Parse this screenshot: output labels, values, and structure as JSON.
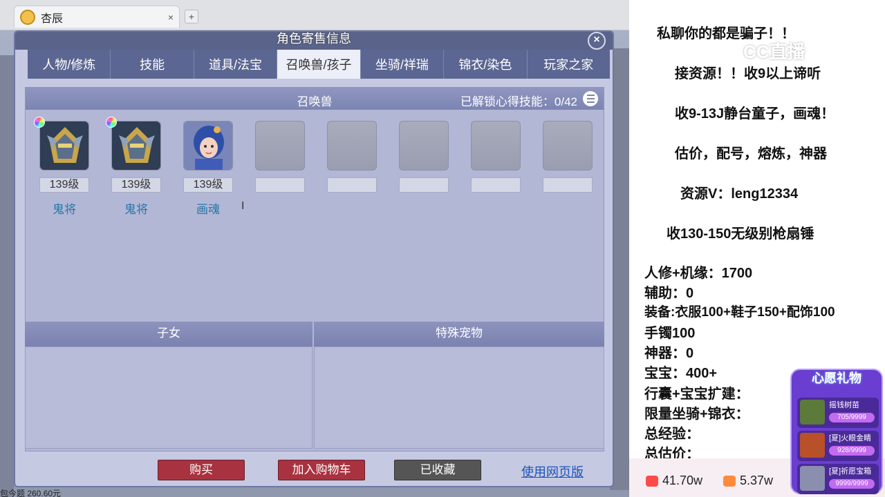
{
  "browser": {
    "tab_title": "杏辰",
    "tab_close": "×",
    "new_tab": "+",
    "bottom_text": "包今题 260.60元"
  },
  "dialog": {
    "title": "角色寄售信息",
    "close": "×",
    "tabs": [
      {
        "label": "人物/修炼",
        "active": false
      },
      {
        "label": "技能",
        "active": false
      },
      {
        "label": "道具/法宝",
        "active": false
      },
      {
        "label": "召唤兽/孩子",
        "active": true
      },
      {
        "label": "坐骑/祥瑞",
        "active": false
      },
      {
        "label": "锦衣/染色",
        "active": false
      },
      {
        "label": "玩家之家",
        "active": false
      }
    ],
    "summon": {
      "header": "召唤兽",
      "skills_label": "已解锁心得技能：0/42",
      "pets": [
        {
          "level": "139级",
          "name": "鬼将",
          "icon": "ghost-general-portrait"
        },
        {
          "level": "139级",
          "name": "鬼将",
          "icon": "ghost-general-portrait"
        },
        {
          "level": "139级",
          "name": "画魂",
          "icon": "painted-soul-portrait"
        }
      ]
    },
    "children_header": "子女",
    "special_pets_header": "特殊宠物",
    "buttons": {
      "buy": "购买",
      "add_to_cart": "加入购物车",
      "favorited": "已收藏",
      "web_version": "使用网页版"
    }
  },
  "stream": {
    "watermark": "CC直播",
    "lines": [
      "私聊你的都是骗子！！",
      "接资源！！收9以上谛听",
      "收9-13J静台童子，画魂！",
      "估价，配号，熔炼，神器",
      "资源V：leng12334",
      "收130-150无级别枪扇锤"
    ],
    "stats": [
      "人修+机缘：1700",
      "辅助：0",
      "装备:衣服100+鞋子150+配饰100",
      "手镯100",
      "神器：0",
      "宝宝：400+",
      "行囊+宝宝扩建：",
      "限量坐骑+锦衣：",
      "总经验：",
      "总估价："
    ],
    "popularity": "41.70w",
    "fans": "5.37w",
    "wish": {
      "title": "心愿礼物",
      "gifts": [
        {
          "name": "摇钱树苗",
          "progress": "705/9999"
        },
        {
          "name": "[夏]火眼金睛",
          "progress": "928/9999"
        },
        {
          "name": "[夏]祈愿宝箱",
          "progress": "9999/9999"
        }
      ]
    }
  }
}
